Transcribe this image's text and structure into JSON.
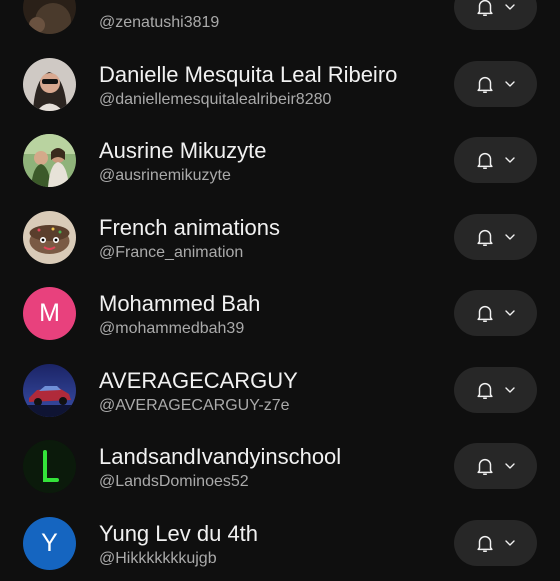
{
  "subscriptions": [
    {
      "name": "",
      "handle": "@zenatushi3819",
      "avatar": {
        "type": "photo",
        "icon": "dark-photo",
        "colors": [
          "#4a3a2c",
          "#2a2018"
        ]
      }
    },
    {
      "name": "Danielle Mesquita Leal Ribeiro",
      "handle": "@daniellemesquitalealribeir8280",
      "avatar": {
        "type": "photo",
        "icon": "woman-with-sunglasses-photo",
        "colors": [
          "#cfc9c4",
          "#2b2420"
        ]
      }
    },
    {
      "name": "Ausrine Mikuzyte",
      "handle": "@ausrinemikuzyte",
      "avatar": {
        "type": "photo",
        "icon": "two-people-outdoors-photo",
        "colors": [
          "#8fb37a",
          "#3c5a2a"
        ]
      }
    },
    {
      "name": "French animations",
      "handle": "@France_animation",
      "avatar": {
        "type": "photo",
        "icon": "cartoon-cake-face-photo",
        "colors": [
          "#d9cbb8",
          "#7a5a44"
        ]
      }
    },
    {
      "name": "Mohammed Bah",
      "handle": "@mohammedbah39",
      "avatar": {
        "type": "initial",
        "letter": "M",
        "colors": [
          "#e8417d"
        ]
      }
    },
    {
      "name": "AVERAGECARGUY",
      "handle": "@AVERAGECARGUY-z7e",
      "avatar": {
        "type": "photo",
        "icon": "car-night-photo",
        "colors": [
          "#2a3f8a",
          "#b02a3a"
        ]
      }
    },
    {
      "name": "LandsandIvandyinschool",
      "handle": "@LandsDominoes52",
      "avatar": {
        "type": "initial",
        "letter": "L",
        "colors": [
          "#0b1a0b",
          "#34e33a"
        ]
      }
    },
    {
      "name": "Yung Lev du 4th",
      "handle": "@Hikkkkkkkujgb",
      "avatar": {
        "type": "initial",
        "letter": "Y",
        "colors": [
          "#1565c0"
        ]
      }
    }
  ],
  "ui": {
    "notify_icon": "bell-icon",
    "dropdown_icon": "chevron-down-icon",
    "button_color": "#272727",
    "background_color": "#0f0f0f",
    "primary_text_color": "#f1f1f1",
    "secondary_text_color": "#aaaaaa"
  }
}
